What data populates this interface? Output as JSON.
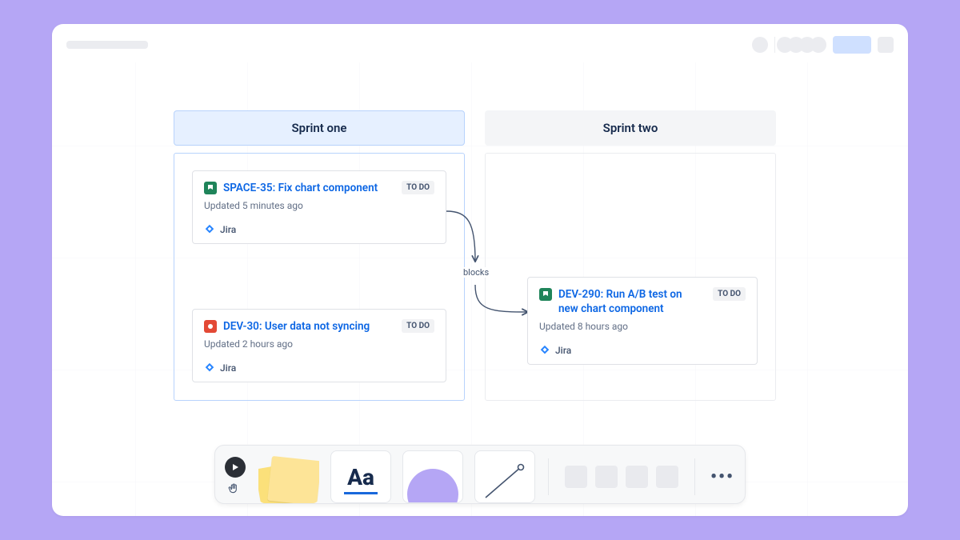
{
  "columns": {
    "one": {
      "title": "Sprint one"
    },
    "two": {
      "title": "Sprint two"
    }
  },
  "connector": {
    "label": "blocks"
  },
  "cards": {
    "space35": {
      "title": "SPACE-35: Fix chart component",
      "status": "TO DO",
      "updated": "Updated 5 minutes ago",
      "source": "Jira",
      "issue_type": "story"
    },
    "dev30": {
      "title": "DEV-30: User data not syncing",
      "status": "TO DO",
      "updated": "Updated 2 hours ago",
      "source": "Jira",
      "issue_type": "bug"
    },
    "dev290": {
      "title": "DEV-290: Run A/B test on new chart component",
      "status": "TO DO",
      "updated": "Updated 8 hours ago",
      "source": "Jira",
      "issue_type": "story"
    }
  },
  "toolbar": {
    "text_label": "Aa",
    "more_label": "•••"
  }
}
